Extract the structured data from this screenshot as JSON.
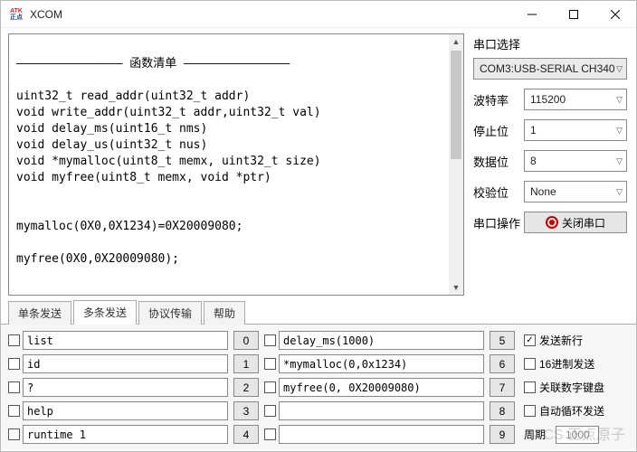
{
  "window": {
    "title": "XCOM",
    "logo_top": "ATK",
    "logo_bot": "正点"
  },
  "terminal": {
    "rule": "———————————————",
    "heading": "函数清单",
    "lines": [
      "uint32_t read_addr(uint32_t addr)",
      "void write_addr(uint32_t addr,uint32_t val)",
      "void delay_ms(uint16_t nms)",
      "void delay_us(uint32_t nus)",
      "void *mymalloc(uint8_t memx, uint32_t size)",
      "void myfree(uint8_t memx, void *ptr)",
      "",
      "",
      "mymalloc(0X0,0X1234)=0X20009080;",
      "",
      "myfree(0X0,0X20009080);"
    ]
  },
  "side": {
    "title": "串口选择",
    "port": "COM3:USB-SERIAL CH340",
    "rows": {
      "baud_label": "波特率",
      "baud": "115200",
      "stop_label": "停止位",
      "stop": "1",
      "data_label": "数据位",
      "data": "8",
      "parity_label": "校验位",
      "parity": "None",
      "op_label": "串口操作",
      "op_button": "关闭串口"
    }
  },
  "tabs": [
    "单条发送",
    "多条发送",
    "协议传输",
    "帮助"
  ],
  "active_tab": 1,
  "grid": {
    "left": [
      {
        "chk": false,
        "val": "list",
        "btn": "0"
      },
      {
        "chk": false,
        "val": "id",
        "btn": "1"
      },
      {
        "chk": false,
        "val": "?",
        "btn": "2"
      },
      {
        "chk": false,
        "val": "help",
        "btn": "3"
      },
      {
        "chk": false,
        "val": "runtime 1",
        "btn": "4"
      }
    ],
    "right": [
      {
        "chk": false,
        "val": "delay_ms(1000)",
        "btn": "5"
      },
      {
        "chk": false,
        "val": "*mymalloc(0,0x1234)",
        "btn": "6"
      },
      {
        "chk": false,
        "val": "myfree(0, 0X20009080)",
        "btn": "7"
      },
      {
        "chk": false,
        "val": "",
        "btn": "8"
      },
      {
        "chk": false,
        "val": "",
        "btn": "9"
      }
    ]
  },
  "options": {
    "send_newline": {
      "label": "发送新行",
      "checked": true
    },
    "hex_send": {
      "label": "16进制发送",
      "checked": false
    },
    "numpad": {
      "label": "关联数字键盘",
      "checked": false
    },
    "auto_loop": {
      "label": "自动循环发送",
      "checked": false
    },
    "period_label": "周期",
    "period_value": "1000"
  },
  "watermark": "CS  正点原子"
}
